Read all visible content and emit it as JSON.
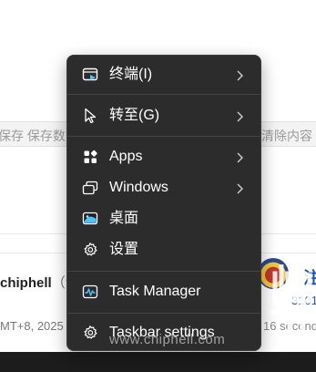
{
  "background": {
    "toolbar_save_text": "保存 保存数",
    "toolbar_clear_text": "清除内容",
    "post_user": "chiphell",
    "post_user_paren": "（注",
    "post_time": "MT+8, 2025",
    "right_char": "注",
    "right_number": "3101",
    "right_time": "16 second"
  },
  "menu": {
    "items": [
      {
        "label": "终端(I)",
        "icon": "terminal-icon",
        "has_submenu": true
      },
      {
        "label": "转至(G)",
        "icon": "cursor-arrow-icon",
        "has_submenu": true
      },
      {
        "label": "Apps",
        "icon": "apps-grid-icon",
        "has_submenu": true
      },
      {
        "label": "Windows",
        "icon": "windows-stack-icon",
        "has_submenu": true
      },
      {
        "label": "桌面",
        "icon": "desktop-icon",
        "has_submenu": false
      },
      {
        "label": "设置",
        "icon": "gear-icon",
        "has_submenu": false
      },
      {
        "label": "Task Manager",
        "icon": "task-manager-icon",
        "has_submenu": false
      },
      {
        "label": "Taskbar settings",
        "icon": "gear-icon",
        "has_submenu": false
      }
    ]
  },
  "watermark": {
    "url": "www.chiphell.com"
  },
  "colors": {
    "menu_bg": "#2c2c2c",
    "accent_blue": "#4cc2ff"
  }
}
